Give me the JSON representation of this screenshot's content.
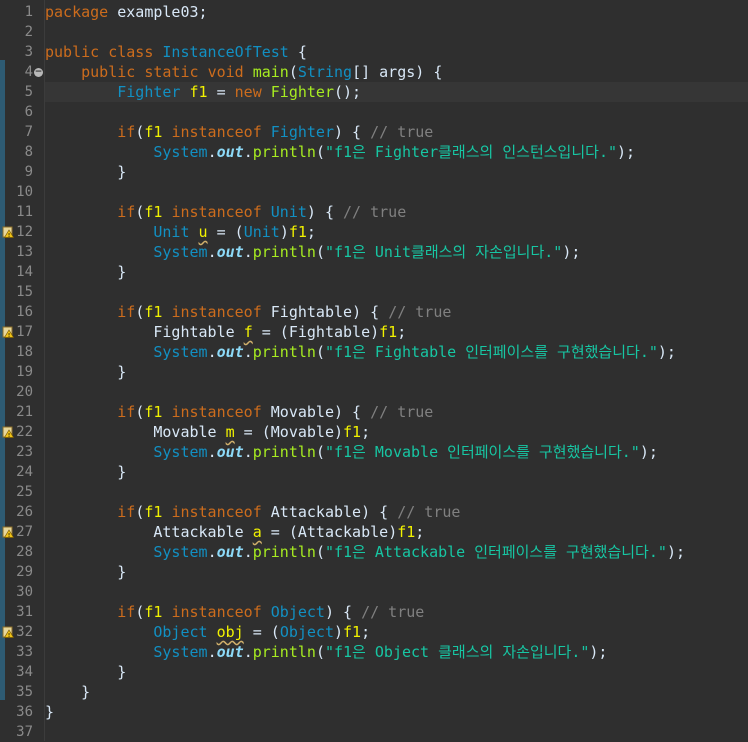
{
  "editor": {
    "current_line": 5,
    "colors": {
      "background": "#2f2f2f",
      "keyword": "#cc6c1d",
      "type": "#1290c3",
      "string": "#17c6a3",
      "comment": "#808080",
      "method": "#a7ec21",
      "field": "#8ddaf8",
      "variable": "#f2f200",
      "plain": "#d9e8f7"
    },
    "fold_lines": [
      4
    ],
    "warning_lines": [
      12,
      17,
      22,
      27,
      32
    ],
    "lines": [
      {
        "n": "1",
        "tokens": [
          {
            "c": "kw",
            "t": "package"
          },
          {
            "c": "plain",
            "t": " example03;"
          }
        ]
      },
      {
        "n": "2",
        "tokens": []
      },
      {
        "n": "3",
        "tokens": [
          {
            "c": "kw",
            "t": "public"
          },
          {
            "c": "plain",
            "t": " "
          },
          {
            "c": "kw",
            "t": "class"
          },
          {
            "c": "plain",
            "t": " "
          },
          {
            "c": "type",
            "t": "InstanceOfTest"
          },
          {
            "c": "plain",
            "t": " {"
          }
        ]
      },
      {
        "n": "4",
        "tokens": [
          {
            "c": "plain",
            "t": "    "
          },
          {
            "c": "kw",
            "t": "public"
          },
          {
            "c": "plain",
            "t": " "
          },
          {
            "c": "kw",
            "t": "static"
          },
          {
            "c": "plain",
            "t": " "
          },
          {
            "c": "kw",
            "t": "void"
          },
          {
            "c": "plain",
            "t": " "
          },
          {
            "c": "method",
            "t": "main"
          },
          {
            "c": "plain",
            "t": "("
          },
          {
            "c": "type",
            "t": "String"
          },
          {
            "c": "plain",
            "t": "[] "
          },
          {
            "c": "plain",
            "t": "args"
          },
          {
            "c": "plain",
            "t": ") {"
          }
        ]
      },
      {
        "n": "5",
        "tokens": [
          {
            "c": "plain",
            "t": "        "
          },
          {
            "c": "type",
            "t": "Fighter"
          },
          {
            "c": "plain",
            "t": " "
          },
          {
            "c": "var",
            "t": "f1"
          },
          {
            "c": "plain",
            "t": " = "
          },
          {
            "c": "kw",
            "t": "new"
          },
          {
            "c": "plain",
            "t": " "
          },
          {
            "c": "method",
            "t": "Fighter"
          },
          {
            "c": "plain",
            "t": "();"
          }
        ]
      },
      {
        "n": "6",
        "tokens": []
      },
      {
        "n": "7",
        "tokens": [
          {
            "c": "plain",
            "t": "        "
          },
          {
            "c": "kw",
            "t": "if"
          },
          {
            "c": "plain",
            "t": "("
          },
          {
            "c": "var",
            "t": "f1"
          },
          {
            "c": "plain",
            "t": " "
          },
          {
            "c": "kw",
            "t": "instanceof"
          },
          {
            "c": "plain",
            "t": " "
          },
          {
            "c": "type",
            "t": "Fighter"
          },
          {
            "c": "plain",
            "t": ") { "
          },
          {
            "c": "cmt",
            "t": "// true"
          }
        ]
      },
      {
        "n": "8",
        "tokens": [
          {
            "c": "plain",
            "t": "            "
          },
          {
            "c": "type",
            "t": "System"
          },
          {
            "c": "plain",
            "t": "."
          },
          {
            "c": "field",
            "t": "out"
          },
          {
            "c": "plain",
            "t": "."
          },
          {
            "c": "method",
            "t": "println"
          },
          {
            "c": "plain",
            "t": "("
          },
          {
            "c": "str",
            "t": "\"f1은 Fighter클래스의 인스턴스입니다.\""
          },
          {
            "c": "plain",
            "t": ");"
          }
        ]
      },
      {
        "n": "9",
        "tokens": [
          {
            "c": "plain",
            "t": "        }"
          }
        ]
      },
      {
        "n": "10",
        "tokens": []
      },
      {
        "n": "11",
        "tokens": [
          {
            "c": "plain",
            "t": "        "
          },
          {
            "c": "kw",
            "t": "if"
          },
          {
            "c": "plain",
            "t": "("
          },
          {
            "c": "var",
            "t": "f1"
          },
          {
            "c": "plain",
            "t": " "
          },
          {
            "c": "kw",
            "t": "instanceof"
          },
          {
            "c": "plain",
            "t": " "
          },
          {
            "c": "type",
            "t": "Unit"
          },
          {
            "c": "plain",
            "t": ") { "
          },
          {
            "c": "cmt",
            "t": "// true"
          }
        ]
      },
      {
        "n": "12",
        "tokens": [
          {
            "c": "plain",
            "t": "            "
          },
          {
            "c": "type",
            "t": "Unit"
          },
          {
            "c": "plain",
            "t": " "
          },
          {
            "c": "var warn",
            "t": "u"
          },
          {
            "c": "plain",
            "t": " = ("
          },
          {
            "c": "type",
            "t": "Unit"
          },
          {
            "c": "plain",
            "t": ")"
          },
          {
            "c": "var",
            "t": "f1"
          },
          {
            "c": "plain",
            "t": ";"
          }
        ]
      },
      {
        "n": "13",
        "tokens": [
          {
            "c": "plain",
            "t": "            "
          },
          {
            "c": "type",
            "t": "System"
          },
          {
            "c": "plain",
            "t": "."
          },
          {
            "c": "field",
            "t": "out"
          },
          {
            "c": "plain",
            "t": "."
          },
          {
            "c": "method",
            "t": "println"
          },
          {
            "c": "plain",
            "t": "("
          },
          {
            "c": "str",
            "t": "\"f1은 Unit클래스의 자손입니다.\""
          },
          {
            "c": "plain",
            "t": ");"
          }
        ]
      },
      {
        "n": "14",
        "tokens": [
          {
            "c": "plain",
            "t": "        }"
          }
        ]
      },
      {
        "n": "15",
        "tokens": []
      },
      {
        "n": "16",
        "tokens": [
          {
            "c": "plain",
            "t": "        "
          },
          {
            "c": "kw",
            "t": "if"
          },
          {
            "c": "plain",
            "t": "("
          },
          {
            "c": "var",
            "t": "f1"
          },
          {
            "c": "plain",
            "t": " "
          },
          {
            "c": "kw",
            "t": "instanceof"
          },
          {
            "c": "plain",
            "t": " "
          },
          {
            "c": "plain",
            "t": "Fightable"
          },
          {
            "c": "plain",
            "t": ") { "
          },
          {
            "c": "cmt",
            "t": "// true"
          }
        ]
      },
      {
        "n": "17",
        "tokens": [
          {
            "c": "plain",
            "t": "            "
          },
          {
            "c": "plain",
            "t": "Fightable"
          },
          {
            "c": "plain",
            "t": " "
          },
          {
            "c": "var warn",
            "t": "f"
          },
          {
            "c": "plain",
            "t": " = ("
          },
          {
            "c": "plain",
            "t": "Fightable"
          },
          {
            "c": "plain",
            "t": ")"
          },
          {
            "c": "var",
            "t": "f1"
          },
          {
            "c": "plain",
            "t": ";"
          }
        ]
      },
      {
        "n": "18",
        "tokens": [
          {
            "c": "plain",
            "t": "            "
          },
          {
            "c": "type",
            "t": "System"
          },
          {
            "c": "plain",
            "t": "."
          },
          {
            "c": "field",
            "t": "out"
          },
          {
            "c": "plain",
            "t": "."
          },
          {
            "c": "method",
            "t": "println"
          },
          {
            "c": "plain",
            "t": "("
          },
          {
            "c": "str",
            "t": "\"f1은 Fightable 인터페이스를 구현했습니다.\""
          },
          {
            "c": "plain",
            "t": ");"
          }
        ]
      },
      {
        "n": "19",
        "tokens": [
          {
            "c": "plain",
            "t": "        }"
          }
        ]
      },
      {
        "n": "20",
        "tokens": []
      },
      {
        "n": "21",
        "tokens": [
          {
            "c": "plain",
            "t": "        "
          },
          {
            "c": "kw",
            "t": "if"
          },
          {
            "c": "plain",
            "t": "("
          },
          {
            "c": "var",
            "t": "f1"
          },
          {
            "c": "plain",
            "t": " "
          },
          {
            "c": "kw",
            "t": "instanceof"
          },
          {
            "c": "plain",
            "t": " "
          },
          {
            "c": "plain",
            "t": "Movable"
          },
          {
            "c": "plain",
            "t": ") { "
          },
          {
            "c": "cmt",
            "t": "// true"
          }
        ]
      },
      {
        "n": "22",
        "tokens": [
          {
            "c": "plain",
            "t": "            "
          },
          {
            "c": "plain",
            "t": "Movable"
          },
          {
            "c": "plain",
            "t": " "
          },
          {
            "c": "var warn",
            "t": "m"
          },
          {
            "c": "plain",
            "t": " = ("
          },
          {
            "c": "plain",
            "t": "Movable"
          },
          {
            "c": "plain",
            "t": ")"
          },
          {
            "c": "var",
            "t": "f1"
          },
          {
            "c": "plain",
            "t": ";"
          }
        ]
      },
      {
        "n": "23",
        "tokens": [
          {
            "c": "plain",
            "t": "            "
          },
          {
            "c": "type",
            "t": "System"
          },
          {
            "c": "plain",
            "t": "."
          },
          {
            "c": "field",
            "t": "out"
          },
          {
            "c": "plain",
            "t": "."
          },
          {
            "c": "method",
            "t": "println"
          },
          {
            "c": "plain",
            "t": "("
          },
          {
            "c": "str",
            "t": "\"f1은 Movable 인터페이스를 구현했습니다.\""
          },
          {
            "c": "plain",
            "t": ");"
          }
        ]
      },
      {
        "n": "24",
        "tokens": [
          {
            "c": "plain",
            "t": "        }"
          }
        ]
      },
      {
        "n": "25",
        "tokens": []
      },
      {
        "n": "26",
        "tokens": [
          {
            "c": "plain",
            "t": "        "
          },
          {
            "c": "kw",
            "t": "if"
          },
          {
            "c": "plain",
            "t": "("
          },
          {
            "c": "var",
            "t": "f1"
          },
          {
            "c": "plain",
            "t": " "
          },
          {
            "c": "kw",
            "t": "instanceof"
          },
          {
            "c": "plain",
            "t": " "
          },
          {
            "c": "plain",
            "t": "Attackable"
          },
          {
            "c": "plain",
            "t": ") { "
          },
          {
            "c": "cmt",
            "t": "// true"
          }
        ]
      },
      {
        "n": "27",
        "tokens": [
          {
            "c": "plain",
            "t": "            "
          },
          {
            "c": "plain",
            "t": "Attackable"
          },
          {
            "c": "plain",
            "t": " "
          },
          {
            "c": "var warn",
            "t": "a"
          },
          {
            "c": "plain",
            "t": " = ("
          },
          {
            "c": "plain",
            "t": "Attackable"
          },
          {
            "c": "plain",
            "t": ")"
          },
          {
            "c": "var",
            "t": "f1"
          },
          {
            "c": "plain",
            "t": ";"
          }
        ]
      },
      {
        "n": "28",
        "tokens": [
          {
            "c": "plain",
            "t": "            "
          },
          {
            "c": "type",
            "t": "System"
          },
          {
            "c": "plain",
            "t": "."
          },
          {
            "c": "field",
            "t": "out"
          },
          {
            "c": "plain",
            "t": "."
          },
          {
            "c": "method",
            "t": "println"
          },
          {
            "c": "plain",
            "t": "("
          },
          {
            "c": "str",
            "t": "\"f1은 Attackable 인터페이스를 구현했습니다.\""
          },
          {
            "c": "plain",
            "t": ");"
          }
        ]
      },
      {
        "n": "29",
        "tokens": [
          {
            "c": "plain",
            "t": "        }"
          }
        ]
      },
      {
        "n": "30",
        "tokens": []
      },
      {
        "n": "31",
        "tokens": [
          {
            "c": "plain",
            "t": "        "
          },
          {
            "c": "kw",
            "t": "if"
          },
          {
            "c": "plain",
            "t": "("
          },
          {
            "c": "var",
            "t": "f1"
          },
          {
            "c": "plain",
            "t": " "
          },
          {
            "c": "kw",
            "t": "instanceof"
          },
          {
            "c": "plain",
            "t": " "
          },
          {
            "c": "type",
            "t": "Object"
          },
          {
            "c": "plain",
            "t": ") { "
          },
          {
            "c": "cmt",
            "t": "// true"
          }
        ]
      },
      {
        "n": "32",
        "tokens": [
          {
            "c": "plain",
            "t": "            "
          },
          {
            "c": "type",
            "t": "Object"
          },
          {
            "c": "plain",
            "t": " "
          },
          {
            "c": "var warn",
            "t": "obj"
          },
          {
            "c": "plain",
            "t": " = ("
          },
          {
            "c": "type",
            "t": "Object"
          },
          {
            "c": "plain",
            "t": ")"
          },
          {
            "c": "var",
            "t": "f1"
          },
          {
            "c": "plain",
            "t": ";"
          }
        ]
      },
      {
        "n": "33",
        "tokens": [
          {
            "c": "plain",
            "t": "            "
          },
          {
            "c": "type",
            "t": "System"
          },
          {
            "c": "plain",
            "t": "."
          },
          {
            "c": "field",
            "t": "out"
          },
          {
            "c": "plain",
            "t": "."
          },
          {
            "c": "method",
            "t": "println"
          },
          {
            "c": "plain",
            "t": "("
          },
          {
            "c": "str",
            "t": "\"f1은 Object 클래스의 자손입니다.\""
          },
          {
            "c": "plain",
            "t": ");"
          }
        ]
      },
      {
        "n": "34",
        "tokens": [
          {
            "c": "plain",
            "t": "        }"
          }
        ]
      },
      {
        "n": "35",
        "tokens": [
          {
            "c": "plain",
            "t": "    }"
          }
        ]
      },
      {
        "n": "36",
        "tokens": [
          {
            "c": "plain",
            "t": "}"
          }
        ]
      },
      {
        "n": "37",
        "tokens": []
      }
    ]
  }
}
